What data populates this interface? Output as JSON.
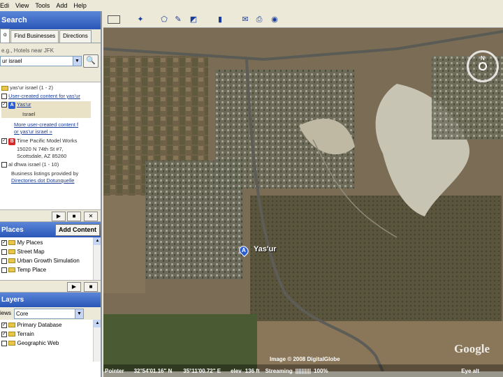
{
  "menu": [
    "Edi",
    "View",
    "Tools",
    "Add",
    "Help"
  ],
  "search": {
    "title": "Search",
    "tabs": [
      "o",
      "Find Businesses",
      "Directions"
    ],
    "hint": "e.g., Hotels near JFK",
    "value": "ur israel"
  },
  "results": {
    "header": "yas'ur israel (1 - 2)",
    "user_link": "User-created content for yas'ur",
    "item_a_label": "A",
    "item_a_name": "Yas'ur",
    "item_a_sub": "Israel",
    "more_link_1": "More user-created content f",
    "more_link_2": "or yas'ur israel »",
    "item_b_label": "B",
    "item_b_name": "Time Pacific Model Works",
    "item_b_addr1": "15020 N 74th St #7,",
    "item_b_addr2": "Scottsdale, AZ 85260",
    "group2": "al dhwa israel (1 - 10)",
    "provided": "Business listings provided by",
    "provided_link": "Directories dot Dotunquelle"
  },
  "controls": {
    "play": "▶",
    "stop": "■",
    "close": "✕"
  },
  "places": {
    "title": "Places",
    "add_content": "Add Content",
    "items": [
      "My Places",
      "Street Map",
      "Urban Growth Simulation",
      "Temp Place"
    ]
  },
  "layers": {
    "title": "Layers",
    "view_label": "iews",
    "view_value": "Core",
    "items": [
      "Primary Database",
      "Terrain",
      "Geographic Web"
    ]
  },
  "map": {
    "placemark_label": "A",
    "placemark_name": "Yas'ur",
    "attribution": "Image © 2008 DigitalGlobe",
    "logo": "Google",
    "compass_letter": "N"
  },
  "status": {
    "pointer_label": "Pointer",
    "lat": "32°54'01.16\" N",
    "lon": "35°11'00.72\" E",
    "elev_label": "elev",
    "elev": "136 ft",
    "streaming_label": "Streaming",
    "streaming_bar": "||||||||||",
    "streaming_pct": "100%",
    "eye_alt_label": "Eye alt"
  },
  "colors": {
    "panel_header": "#2a56b8",
    "link": "#1a3d9a",
    "map_base": "#7a6b52"
  }
}
